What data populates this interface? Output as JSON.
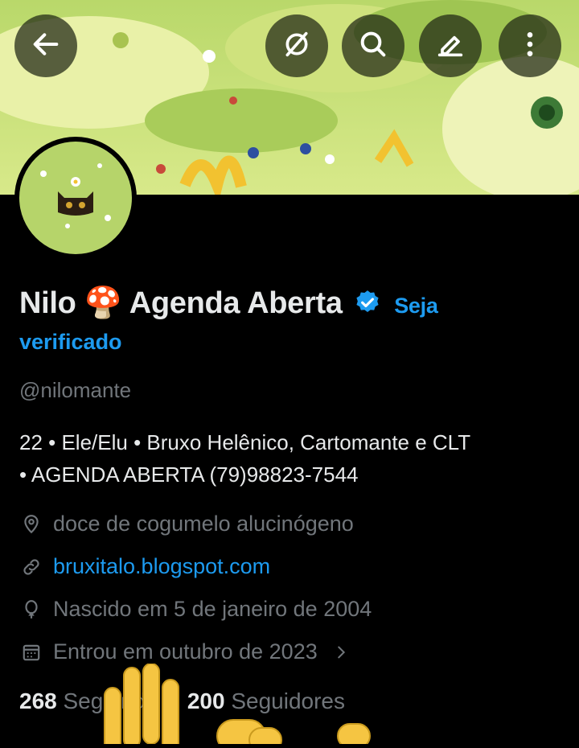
{
  "header": {
    "back_icon": "arrow-left-icon",
    "actions": [
      "no-sync-icon",
      "search-icon",
      "edit-icon",
      "more-vertical-icon"
    ]
  },
  "profile": {
    "name_part1": "Nilo",
    "name_emoji": "🍄",
    "name_part2": "Agenda Aberta",
    "verified_cta_line1": "Seja",
    "verified_cta_line2": "verificado",
    "handle": "@nilomante",
    "bio_line1": "22 • Ele/Elu • Bruxo Helênico, Cartomante e CLT",
    "bio_line2": "• AGENDA ABERTA (79)98823-7544",
    "location": "doce de cogumelo alucinógeno",
    "website": "bruxitalo.blogspot.com",
    "birthday": "Nascido em 5 de janeiro de 2004",
    "joined": "Entrou em outubro de 2023"
  },
  "stats": {
    "following_count": "268",
    "following_label": "Seguindo",
    "followers_count": "200",
    "followers_label": "Seguidores"
  },
  "colors": {
    "accent": "#1d9bf0",
    "muted": "#71767b",
    "text": "#e7e9ea",
    "background": "#000000"
  }
}
